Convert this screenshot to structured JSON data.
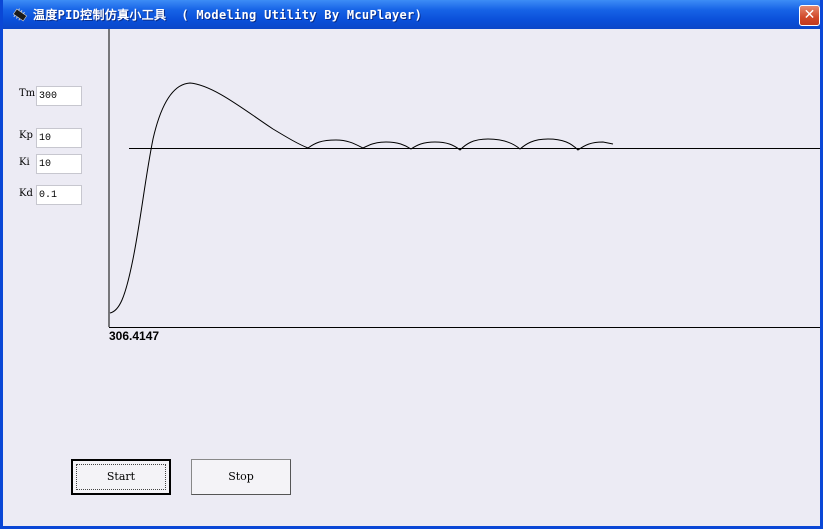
{
  "window": {
    "title": "温度PID控制仿真小工具  ( Modeling Utility By McuPlayer)",
    "close_glyph": "✕"
  },
  "params": [
    {
      "label": "Tm",
      "value": "300"
    },
    {
      "label": "Kp",
      "value": "10"
    },
    {
      "label": "Ki",
      "value": "10"
    },
    {
      "label": "Kd",
      "value": "0.1"
    }
  ],
  "readout": "306.4147",
  "buttons": {
    "start": "Start",
    "stop": "Stop"
  },
  "colors": {
    "titlebar": "#0a4fd9",
    "curve": "#000000",
    "background": "#ecebf4"
  }
}
